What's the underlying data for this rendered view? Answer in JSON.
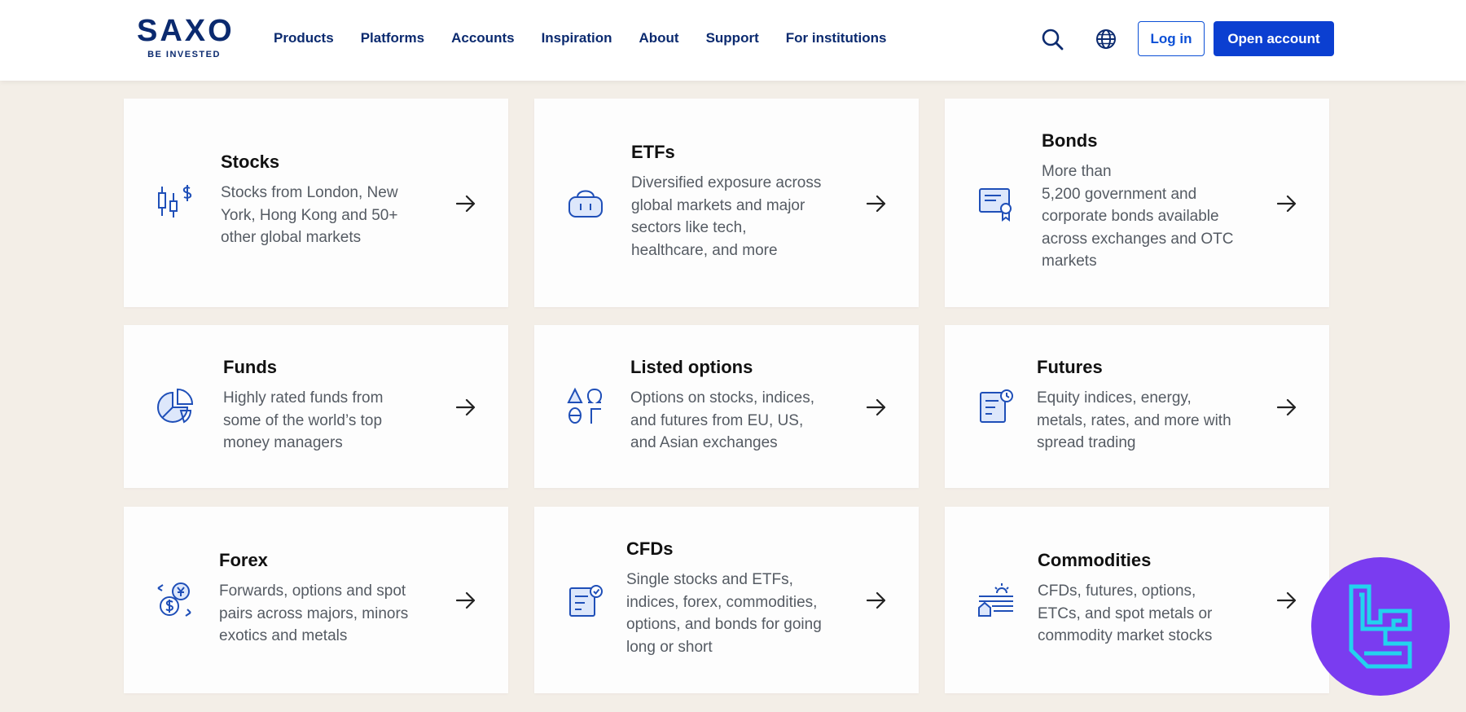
{
  "header": {
    "logo": {
      "word": "SAXO",
      "tagline": "BE INVESTED"
    },
    "nav": [
      "Products",
      "Platforms",
      "Accounts",
      "Inspiration",
      "About",
      "Support",
      "For institutions"
    ],
    "search_icon": "search-icon",
    "language_icon": "globe-icon",
    "login_label": "Log in",
    "open_account_label": "Open account"
  },
  "cards": [
    {
      "title": "Stocks",
      "icon": "candlestick-icon",
      "lines": [
        "Stocks from London, New",
        "York, Hong Kong and 50+",
        "other global markets"
      ]
    },
    {
      "title": "ETFs",
      "icon": "basket-icon",
      "lines": [
        "Diversified exposure across",
        "global markets and major",
        "sectors like tech,",
        "healthcare, and more"
      ]
    },
    {
      "title": "Bonds",
      "icon": "certificate-icon",
      "lines": [
        "More than",
        "5,200 government and",
        "corporate bonds available",
        "across exchanges and OTC",
        "markets"
      ]
    },
    {
      "title": "Funds",
      "icon": "pie-chart-icon",
      "lines": [
        "Highly rated funds from",
        "some of the world’s top",
        "money managers"
      ]
    },
    {
      "title": "Listed options",
      "icon": "greek-symbols-icon",
      "lines": [
        "Options on stocks, indices,",
        "and futures from EU, US,",
        "and Asian exchanges"
      ]
    },
    {
      "title": "Futures",
      "icon": "document-clock-icon",
      "lines": [
        "Equity indices, energy,",
        "metals, rates, and more with",
        "spread trading"
      ]
    },
    {
      "title": "Forex",
      "icon": "currency-exchange-icon",
      "lines": [
        "Forwards, options and spot",
        "pairs across majors, minors",
        "exotics and metals"
      ]
    },
    {
      "title": "CFDs",
      "icon": "document-check-icon",
      "lines": [
        "Single stocks and ETFs,",
        "indices, forex, commodities,",
        "options, and bonds for going",
        "long or short"
      ]
    },
    {
      "title": "Commodities",
      "icon": "farm-sun-icon",
      "lines": [
        "CFDs, futures, options,",
        "ETCs, and spot metals or",
        "commodity market stocks"
      ]
    }
  ],
  "colors": {
    "navy": "#0b2a6f",
    "blue": "#0b3fd1",
    "background": "#f3eee7",
    "badge": "#7a3cf0",
    "badge_mark": "#22d3ee"
  }
}
